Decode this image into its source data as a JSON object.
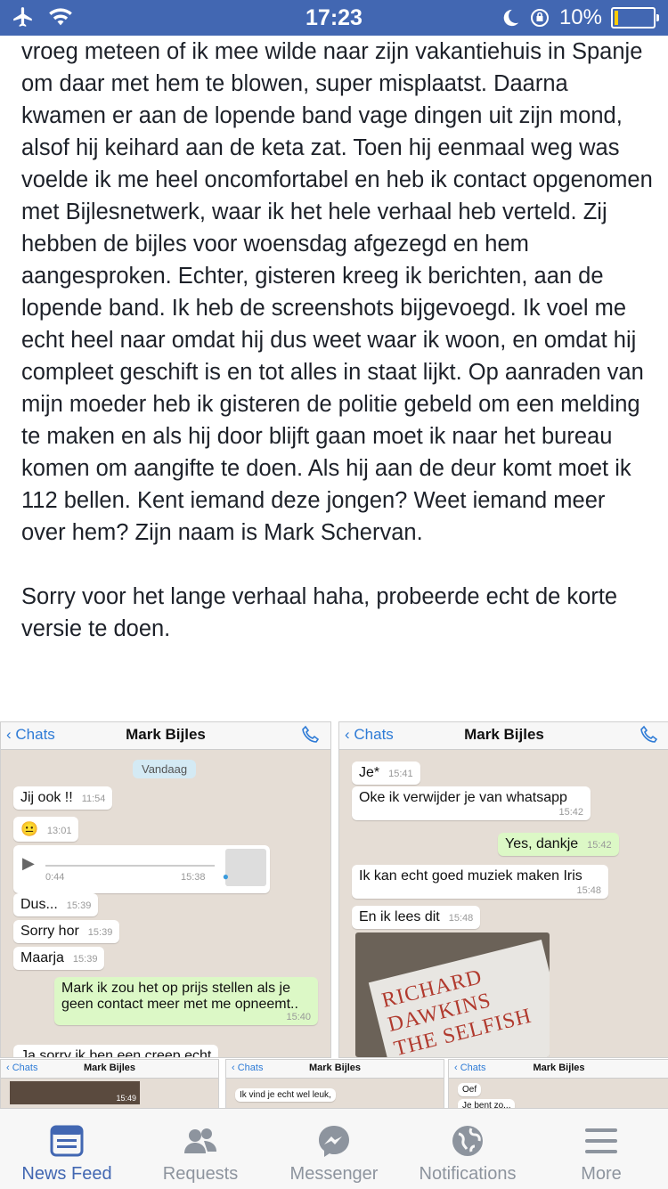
{
  "status": {
    "time": "17:23",
    "battery_text": "10%",
    "battery_level": 0.1
  },
  "post": {
    "paragraph1": "vroeg meteen of ik mee wilde naar zijn vakantiehuis in Spanje om daar met hem te blowen, super misplaatst. Daarna kwamen er aan de lopende band vage dingen uit zijn mond, alsof hij keihard aan de keta zat. Toen hij eenmaal weg was voelde ik me heel oncomfortabel en heb ik contact opgenomen met Bijlesnetwerk, waar ik het hele verhaal heb verteld. Zij hebben de bijles voor woensdag afgezegd en hem aangesproken. Echter, gisteren kreeg ik berichten, aan de lopende band. Ik heb de screenshots bijgevoegd. Ik voel me echt heel naar omdat hij dus weet waar ik woon, en omdat hij compleet geschift is en tot alles in staat lijkt. Op aanraden van mijn moeder heb ik gisteren de politie gebeld om een melding te maken en als hij door blijft gaan moet ik naar het bureau komen om aangifte te doen. Als hij aan de deur komt moet ik 112 bellen. Kent iemand deze jongen? Weet iemand meer over hem? Zijn naam is Mark Schervan.",
    "paragraph2": "Sorry voor het lange verhaal haha, probeerde echt de korte versie te doen."
  },
  "shot1": {
    "back": "Chats",
    "title": "Mark Bijles",
    "date_pill": "Vandaag",
    "messages": [
      {
        "text": "Jij ook !!",
        "time": "11:54"
      },
      {
        "text": "😐",
        "time": "13:01"
      },
      {
        "voice_duration": "0:44",
        "time": "15:38"
      },
      {
        "text": "Dus...",
        "time": "15:39"
      },
      {
        "text": "Sorry hor",
        "time": "15:39"
      },
      {
        "text": "Maarja",
        "time": "15:39"
      },
      {
        "text": "Mark ik zou het op prijs stellen als je geen contact meer met me opneemt..",
        "time": "15:40"
      },
      {
        "text": "Ja sorry ik ben een creep echt"
      }
    ]
  },
  "shot2": {
    "back": "Chats",
    "title": "Mark Bijles",
    "messages": [
      {
        "text": "Je*",
        "time": "15:41"
      },
      {
        "text": "Oke ik verwijder je van whatsapp",
        "time": "15:42"
      },
      {
        "text": "Yes, dankje",
        "time": "15:42"
      },
      {
        "text": "Ik kan echt goed muziek maken Iris",
        "time": "15:48"
      },
      {
        "text": "En ik lees dit",
        "time": "15:48"
      }
    ],
    "book_text": "RICHARD DAWKINS THE SELFISH"
  },
  "shot3": {
    "back": "Chats",
    "title": "Mark Bijles",
    "time": "15:49"
  },
  "shot4": {
    "back": "Chats",
    "title": "Mark Bijles",
    "text": "Ik vind je echt wel leuk,"
  },
  "shot5": {
    "back": "Chats",
    "title": "Mark Bijles",
    "text1": "Oef",
    "text2": "Je bent zo..."
  },
  "tabs": [
    {
      "label": "News Feed",
      "icon": "news-feed-icon"
    },
    {
      "label": "Requests",
      "icon": "friend-requests-icon"
    },
    {
      "label": "Messenger",
      "icon": "messenger-icon"
    },
    {
      "label": "Notifications",
      "icon": "globe-icon"
    },
    {
      "label": "More",
      "icon": "menu-icon"
    }
  ],
  "colors": {
    "brand": "#4267b2",
    "chat_bg": "#e5ddd5",
    "outgoing_bubble": "#dcf8c6"
  }
}
